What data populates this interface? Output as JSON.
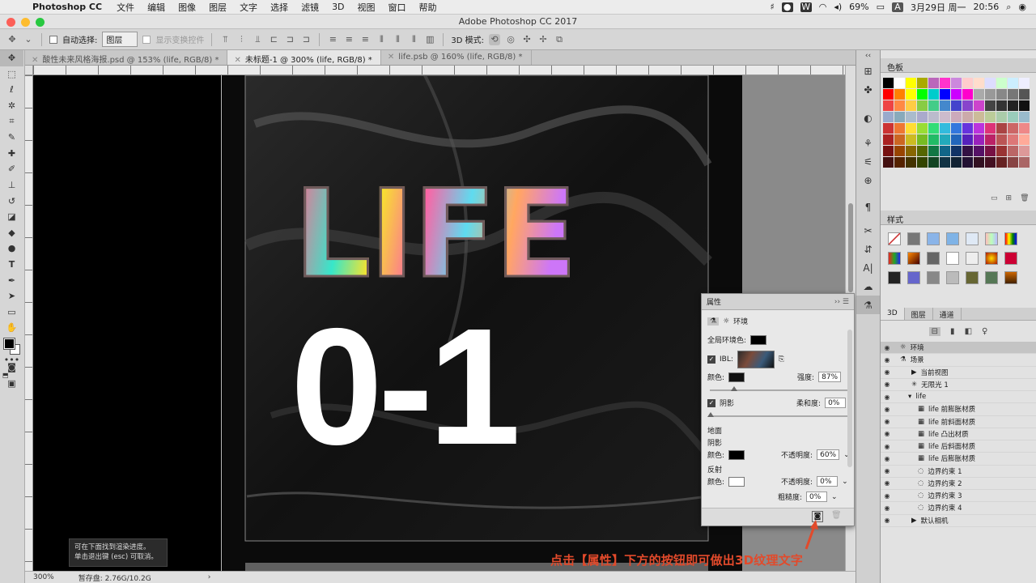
{
  "menubar": {
    "app_name": "Photoshop CC",
    "items": [
      "文件",
      "编辑",
      "图像",
      "图层",
      "文字",
      "选择",
      "滤镜",
      "3D",
      "视图",
      "窗口",
      "帮助"
    ],
    "battery": "69%",
    "input_method": "A",
    "datetime": "3月29日 周一",
    "time": "20:56"
  },
  "window": {
    "title": "Adobe Photoshop CC 2017"
  },
  "options": {
    "auto_select_label": "自动选择:",
    "auto_select_value": "图层",
    "transform_controls_label": "显示变换控件",
    "mode_3d_label": "3D 模式:"
  },
  "tabs": [
    {
      "label": "酸性未来风格海报.psd @ 153% (life, RGB/8) *"
    },
    {
      "label": "未标题-1 @ 300% (life, RGB/8) *"
    },
    {
      "label": "life.psb @ 160% (life, RGB/8) *"
    }
  ],
  "canvas": {
    "life_text": "LIFE",
    "number_text": "0-1"
  },
  "tip": {
    "line1": "可在下面找到渲染进度。",
    "line2": "单击退出键 (esc) 可取消。"
  },
  "status": {
    "zoom": "300%",
    "scratch": "暂存盘: 2.76G/10.2G"
  },
  "subtitle": "点击【属性】下方的按钮即可做出3D纹理文字",
  "properties": {
    "title": "属性",
    "section": "环境",
    "global_ambient_label": "全局环境色:",
    "ibl_label": "IBL:",
    "color_label": "颜色:",
    "intensity_label": "强度:",
    "intensity_value": "87%",
    "shadow_label": "阴影",
    "softness_label": "柔和度:",
    "softness_value": "0%",
    "ground_label": "地面",
    "ground_shadow_label": "阴影",
    "ground_color_label": "颜色:",
    "opacity_label": "不透明度:",
    "opacity_value": "60%",
    "reflection_label": "反射",
    "reflection_color_label": "颜色:",
    "reflection_opacity_label": "不透明度:",
    "reflection_opacity_value": "0%",
    "roughness_label": "粗糙度:",
    "roughness_value": "0%"
  },
  "panels": {
    "swatches_title": "色板",
    "styles_title": "样式",
    "tabs_3d": [
      "3D",
      "图层",
      "通道"
    ]
  },
  "scene": {
    "items": [
      {
        "label": "环境",
        "selected": true
      },
      {
        "label": "场景"
      },
      {
        "label": "当前视图"
      },
      {
        "label": "无限光 1"
      },
      {
        "label": "life"
      },
      {
        "label": "life 前膨胀材质"
      },
      {
        "label": "life 前斜面材质"
      },
      {
        "label": "life 凸出材质"
      },
      {
        "label": "life 后斜面材质"
      },
      {
        "label": "life 后膨胀材质"
      },
      {
        "label": "边界约束 1"
      },
      {
        "label": "边界约束 2"
      },
      {
        "label": "边界约束 3"
      },
      {
        "label": "边界约束 4"
      },
      {
        "label": "默认相机"
      }
    ]
  },
  "colors": {
    "accent_subtitle": "#e24a2b",
    "canvas_bg": "#0b0b0b"
  }
}
